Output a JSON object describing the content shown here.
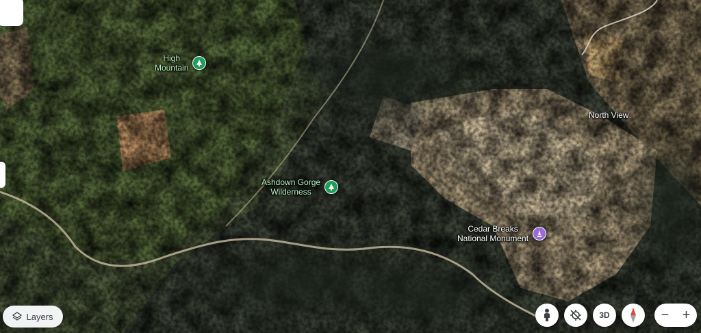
{
  "places": [
    {
      "id": "high-mountain",
      "label": "High\nMountain",
      "pin": "tree-icon",
      "color": "green"
    },
    {
      "id": "ashdown-gorge",
      "label": "Ashdown Gorge\nWilderness",
      "pin": "tree-icon",
      "color": "green"
    },
    {
      "id": "north-view",
      "label": "North View",
      "pin": "",
      "color": "white"
    },
    {
      "id": "cedar-breaks",
      "label": "Cedar Breaks\nNational Monument",
      "pin": "monument-icon",
      "color": "purple"
    }
  ],
  "controls": {
    "layers_label": "Layers",
    "tilt_label": "3D",
    "zoom_out": "−",
    "zoom_in": "+",
    "street_view": "pegman-icon",
    "compass": "compass-icon"
  },
  "colors": {
    "green_pin": "#1e9e5a",
    "purple_pin": "#9a6ad6",
    "label_green": "#b9f3bd"
  }
}
